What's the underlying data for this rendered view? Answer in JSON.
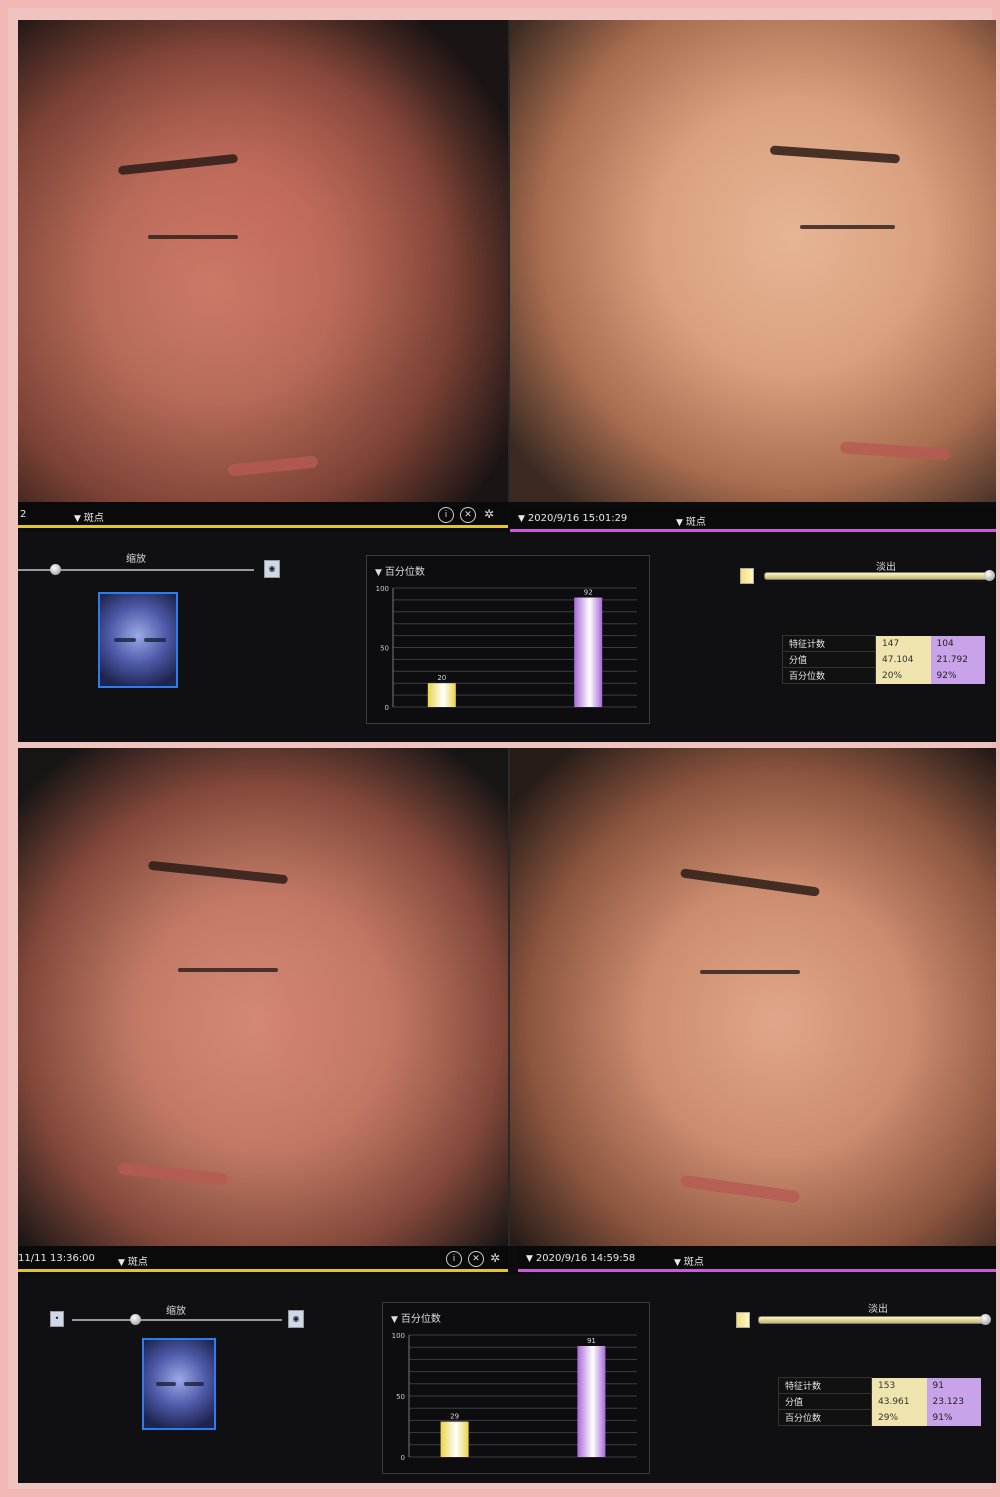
{
  "panels": [
    {
      "left_header": {
        "timestamp": "2",
        "feature": "斑点"
      },
      "right_header": {
        "timestamp": "2020/9/16 15:01:29",
        "feature": "斑点"
      },
      "zoom_label": "缩放",
      "fade_label": "淡出",
      "chart": {
        "title": "百分位数",
        "type": "bar",
        "ylim": [
          0,
          100
        ],
        "yticks": [
          "100",
          "50",
          "0"
        ],
        "values": [
          20,
          92
        ],
        "value_labels": [
          "20",
          "92"
        ],
        "colors": [
          "#e9d44a",
          "#a86ad8"
        ]
      },
      "stats": [
        {
          "label": "特征计数",
          "a": "147",
          "b": "104"
        },
        {
          "label": "分值",
          "a": "47.104",
          "b": "21.792"
        },
        {
          "label": "百分位数",
          "a": "20%",
          "b": "92%"
        }
      ]
    },
    {
      "left_header": {
        "timestamp": "11/11 13:36:00",
        "feature": "斑点"
      },
      "right_header": {
        "timestamp": "2020/9/16 14:59:58",
        "feature": "斑点"
      },
      "zoom_label": "缩放",
      "fade_label": "淡出",
      "chart": {
        "title": "百分位数",
        "type": "bar",
        "ylim": [
          0,
          100
        ],
        "yticks": [
          "100",
          "50",
          "0"
        ],
        "values": [
          29,
          91
        ],
        "value_labels": [
          "29",
          "91"
        ],
        "colors": [
          "#e9d44a",
          "#a86ad8"
        ]
      },
      "stats": [
        {
          "label": "特征计数",
          "a": "153",
          "b": "91"
        },
        {
          "label": "分值",
          "a": "43.961",
          "b": "23.123"
        },
        {
          "label": "百分位数",
          "a": "29%",
          "b": "91%"
        }
      ]
    }
  ],
  "icons": {
    "info": "i",
    "close": "✕",
    "settings": "✲"
  }
}
